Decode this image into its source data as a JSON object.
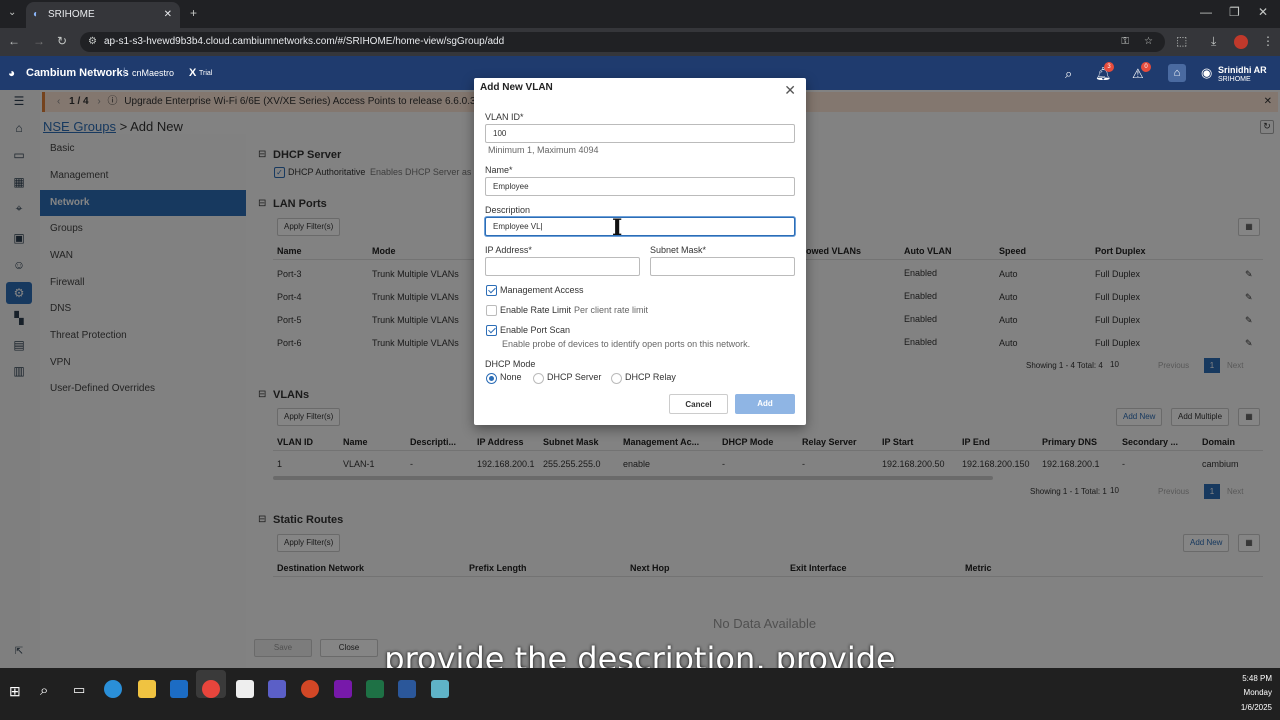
{
  "browser": {
    "tab_title": "SRIHOME",
    "url": "ap-s1-s3-hvewd9b3b4.cloud.cambiumnetworks.com/#/SRIHOME/home-view/sgGroup/add"
  },
  "app": {
    "brand": "Cambium Networks",
    "product": "cnMaestro",
    "product_suffix": "X",
    "trial": "Trial",
    "user_name": "Srinidhi AR",
    "user_org": "SRIHOME",
    "notif_count": "3",
    "alarm_count": "0"
  },
  "banner": {
    "pager": "1 / 4",
    "text": "Upgrade Enterprise Wi-Fi 6/6E (XV/XE Series) Access Points to release 6.6.0.3-r9. Pl"
  },
  "breadcrumb": {
    "root": "NSE Groups",
    "current": " > Add New"
  },
  "sidenav": [
    "Basic",
    "Management",
    "Network",
    "Groups",
    "WAN",
    "Firewall",
    "DNS",
    "Threat Protection",
    "VPN",
    "User-Defined Overrides"
  ],
  "dhcp": {
    "title": "DHCP Server",
    "auth_label": "DHCP Authoritative",
    "auth_desc": "Enables DHCP Server as"
  },
  "lan": {
    "title": "LAN Ports",
    "filter_btn": "Apply Filter(s)",
    "headers": [
      "Name",
      "Mode",
      "owed VLANs",
      "Auto VLAN",
      "Speed",
      "Port Duplex"
    ],
    "rows": [
      [
        "Port-3",
        "Trunk Multiple VLANs",
        "Enabled",
        "Auto",
        "Full Duplex"
      ],
      [
        "Port-4",
        "Trunk Multiple VLANs",
        "Enabled",
        "Auto",
        "Full Duplex"
      ],
      [
        "Port-5",
        "Trunk Multiple VLANs",
        "Enabled",
        "Auto",
        "Full Duplex"
      ],
      [
        "Port-6",
        "Trunk Multiple VLANs",
        "Enabled",
        "Auto",
        "Full Duplex"
      ]
    ],
    "footer": "Showing 1 - 4 Total: 4",
    "page_size": "10",
    "prev": "Previous",
    "page": "1",
    "next": "Next"
  },
  "vlans": {
    "title": "VLANs",
    "filter_btn": "Apply Filter(s)",
    "add_new": "Add New",
    "add_multiple": "Add Multiple",
    "headers": [
      "VLAN ID",
      "Name",
      "Descripti...",
      "IP Address",
      "Subnet Mask",
      "Management Ac...",
      "DHCP Mode",
      "Relay Server",
      "IP Start",
      "IP End",
      "Primary DNS",
      "Secondary ...",
      "Domain"
    ],
    "rows": [
      [
        "1",
        "VLAN-1",
        "-",
        "192.168.200.1",
        "255.255.255.0",
        "enable",
        "-",
        "-",
        "192.168.200.50",
        "192.168.200.150",
        "192.168.200.1",
        "-",
        "cambium"
      ]
    ],
    "footer": "Showing 1 - 1 Total: 1",
    "page_size": "10",
    "prev": "Previous",
    "page": "1",
    "next": "Next"
  },
  "routes": {
    "title": "Static Routes",
    "filter_btn": "Apply Filter(s)",
    "add_new": "Add New",
    "headers": [
      "Destination Network",
      "Prefix Length",
      "Next Hop",
      "Exit Interface",
      "Metric"
    ],
    "empty": "No Data Available"
  },
  "footer_buttons": {
    "save": "Save",
    "close": "Close"
  },
  "modal": {
    "title": "Add New VLAN",
    "vlan_id_label": "VLAN ID*",
    "vlan_id_value": "100",
    "vlan_id_hint": "Minimum 1, Maximum 4094",
    "name_label": "Name*",
    "name_value": "Employee",
    "desc_label": "Description",
    "desc_value": "Employee VL",
    "ip_label": "IP Address*",
    "mask_label": "Subnet Mask*",
    "mgmt_access": "Management Access",
    "rate_limit": "Enable Rate Limit",
    "rate_limit_hint": "Per client rate limit",
    "port_scan": "Enable Port Scan",
    "port_scan_hint": "Enable probe of devices to identify open ports on this network.",
    "dhcp_mode_label": "DHCP Mode",
    "dhcp_modes": [
      "None",
      "DHCP Server",
      "DHCP Relay"
    ],
    "cancel": "Cancel",
    "add": "Add"
  },
  "caption": "provide the description, provide",
  "taskbar": {
    "time": "5:48 PM",
    "day": "Monday",
    "date": "1/6/2025"
  },
  "colors": {
    "accent": "#2c6db6",
    "header": "#1f3b6e",
    "banner": "#fbe4d5"
  }
}
